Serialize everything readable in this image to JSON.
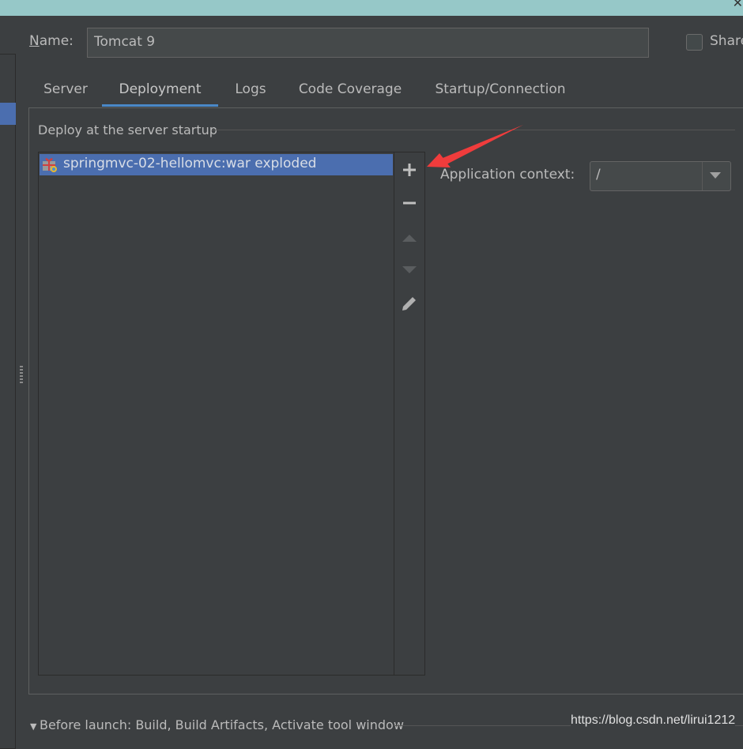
{
  "name_label_first": "N",
  "name_label_rest": "ame:",
  "name_value": "Tomcat 9",
  "share_label": "Share",
  "tabs": [
    "Server",
    "Deployment",
    "Logs",
    "Code Coverage",
    "Startup/Connection"
  ],
  "active_tab": "Deployment",
  "deploy_title": "Deploy at the server startup",
  "artifacts": [
    "springmvc-02-hellomvc:war exploded"
  ],
  "toolbar": [
    "add",
    "remove",
    "move-up",
    "move-down",
    "edit"
  ],
  "app_context_label": "Application context:",
  "app_context_value": "/",
  "before_launch": "Before launch: Build, Build Artifacts, Activate tool window",
  "watermark": "https://blog.csdn.net/lirui1212",
  "colors": {
    "accent": "#4a88c7",
    "selection": "#4b6eaf",
    "annotation_arrow": "#f03c3c",
    "title_band": "#96c8c8"
  }
}
